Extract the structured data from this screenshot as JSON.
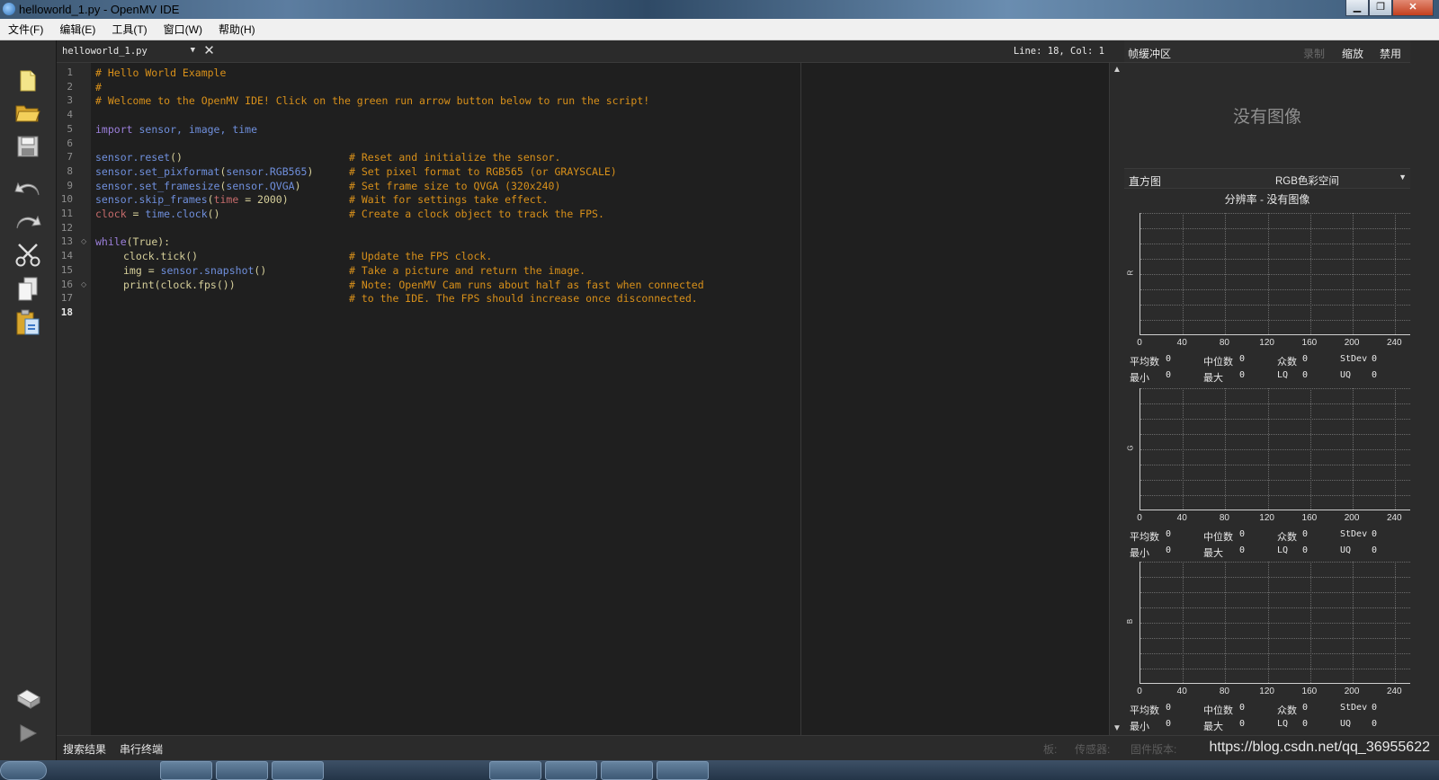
{
  "window": {
    "title": "helloworld_1.py - OpenMV IDE"
  },
  "menubar": [
    "文件(F)",
    "编辑(E)",
    "工具(T)",
    "窗口(W)",
    "帮助(H)"
  ],
  "toolbar_icons": [
    "new-file-icon",
    "open-folder-icon",
    "save-icon",
    "undo-icon",
    "redo-icon",
    "cut-icon",
    "copy-icon",
    "paste-icon",
    "connect-icon",
    "run-icon"
  ],
  "editor": {
    "file_tab": "helloworld_1.py",
    "cursor": "Line: 18, Col: 1",
    "line_numbers": [
      "1",
      "2",
      "3",
      "4",
      "5",
      "6",
      "7",
      "8",
      "9",
      "10",
      "11",
      "12",
      "13",
      "14",
      "15",
      "16",
      "17",
      "18"
    ],
    "active_line": 18
  },
  "framebuffer": {
    "title": "帧缓冲区",
    "record": "录制",
    "zoom": "缩放",
    "disable": "禁用",
    "no_image": "没有图像"
  },
  "histogram": {
    "title": "直方图",
    "colorspace": "RGB色彩空间",
    "resolution": "分辨率 - 没有图像",
    "ticks": [
      "0",
      "40",
      "80",
      "120",
      "160",
      "200",
      "240"
    ],
    "channels": [
      {
        "label": "R",
        "mean_label": "平均数",
        "mean": "0",
        "median_label": "中位数",
        "median": "0",
        "mode_label": "众数",
        "mode": "0",
        "stdev_label": "StDev",
        "stdev": "0",
        "min_label": "最小",
        "min": "0",
        "max_label": "最大",
        "max": "0",
        "lq_label": "LQ",
        "lq": "0",
        "uq_label": "UQ",
        "uq": "0"
      },
      {
        "label": "G",
        "mean_label": "平均数",
        "mean": "0",
        "median_label": "中位数",
        "median": "0",
        "mode_label": "众数",
        "mode": "0",
        "stdev_label": "StDev",
        "stdev": "0",
        "min_label": "最小",
        "min": "0",
        "max_label": "最大",
        "max": "0",
        "lq_label": "LQ",
        "lq": "0",
        "uq_label": "UQ",
        "uq": "0"
      },
      {
        "label": "B",
        "mean_label": "平均数",
        "mean": "0",
        "median_label": "中位数",
        "median": "0",
        "mode_label": "众数",
        "mode": "0",
        "stdev_label": "StDev",
        "stdev": "0",
        "min_label": "最小",
        "min": "0",
        "max_label": "最大",
        "max": "0",
        "lq_label": "LQ",
        "lq": "0",
        "uq_label": "UQ",
        "uq": "0"
      }
    ]
  },
  "bottombar": {
    "search_results": "搜索结果",
    "serial_terminal": "串行终端",
    "board": "板:",
    "sensor": "传感器:",
    "firmware": "固件版本:",
    "watermark": "https://blog.csdn.net/qq_36955622"
  },
  "code": {
    "l1": "# Hello World Example",
    "l2": "#",
    "l3": "# Welcome to the OpenMV IDE! Click on the green run arrow button below to run the script!",
    "l5_kw": "import",
    "l5_rest": " sensor, image, time",
    "l7_a": "sensor.reset",
    "l7_b": "()",
    "l7_c": "# Reset and initialize the sensor.",
    "l8_a": "sensor.set_pixformat",
    "l8_b": "(",
    "l8_c": "sensor.RGB565",
    "l8_d": ")",
    "l8_e": "# Set pixel format to RGB565 (or GRAYSCALE)",
    "l9_a": "sensor.set_framesize",
    "l9_b": "(",
    "l9_c": "sensor.QVGA",
    "l9_d": ")",
    "l9_e": "# Set frame size to QVGA (320x240)",
    "l10_a": "sensor.skip_frames",
    "l10_b": "(",
    "l10_c": "time",
    "l10_d": " = 2000)",
    "l10_e": "# Wait for settings take effect.",
    "l11_a": "clock",
    "l11_b": " = ",
    "l11_c": "time.clock",
    "l11_d": "()",
    "l11_e": "# Create a clock object to track the FPS.",
    "l13_a": "while",
    "l13_b": "(True):",
    "l14_a": "clock.tick",
    "l14_b": "()",
    "l14_c": "# Update the FPS clock.",
    "l15_a": "img",
    "l15_b": " = ",
    "l15_c": "sensor.snapshot",
    "l15_d": "()",
    "l15_e": "# Take a picture and return the image.",
    "l16_a": "print",
    "l16_b": "(clock.fps())",
    "l16_c": "# Note: OpenMV Cam runs about half as fast when connected",
    "l17": "# to the IDE. The FPS should increase once disconnected."
  }
}
